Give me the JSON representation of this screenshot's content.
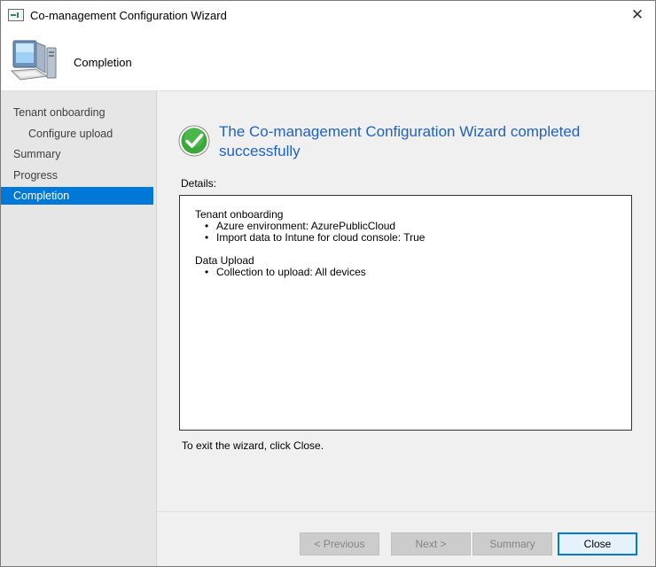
{
  "window": {
    "title": "Co-management Configuration Wizard"
  },
  "icons": {
    "app": "wizard-app-icon",
    "close": "close-icon",
    "header": "computer-icon",
    "success": "checkmark-circle-icon"
  },
  "colors": {
    "accent": "#0078d7",
    "title_blue": "#1f62c2",
    "success_green": "#3aa83a"
  },
  "header": {
    "title": "Completion"
  },
  "sidebar": {
    "items": [
      {
        "label": "Tenant onboarding",
        "active": false,
        "indent": false
      },
      {
        "label": "Configure upload",
        "active": false,
        "indent": true
      },
      {
        "label": "Summary",
        "active": false,
        "indent": false
      },
      {
        "label": "Progress",
        "active": false,
        "indent": false
      },
      {
        "label": "Completion",
        "active": true,
        "indent": false
      }
    ]
  },
  "main": {
    "success_title": "The Co-management Configuration Wizard completed successfully",
    "details_label": "Details:",
    "details": {
      "sections": [
        {
          "title": "Tenant onboarding",
          "items": [
            "Azure environment: AzurePublicCloud",
            "Import data to Intune for cloud console: True"
          ]
        },
        {
          "title": "Data Upload",
          "items": [
            "Collection to upload: All devices"
          ]
        }
      ]
    },
    "exit_hint": "To exit the wizard, click Close."
  },
  "footer": {
    "previous_label": "< Previous",
    "next_label": "Next >",
    "summary_label": "Summary",
    "close_label": "Close"
  }
}
